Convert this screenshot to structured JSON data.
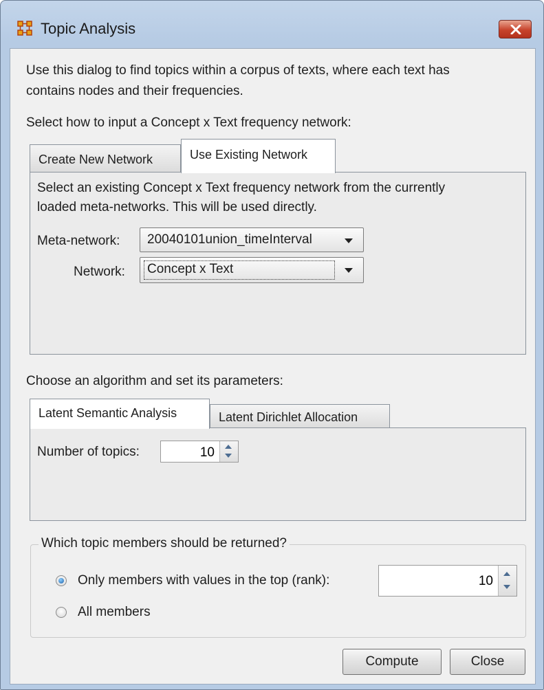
{
  "window": {
    "title": "Topic Analysis",
    "app_icon": "network-grid-icon",
    "close_icon": "close-icon"
  },
  "intro": "Use this dialog to find topics within a corpus of texts, where each text has contains nodes and their frequencies.",
  "intro_line1": "Use this dialog to find topics within a corpus of texts, where each text has",
  "intro_line2": "contains nodes and their frequencies.",
  "input_section": {
    "label": "Select how to input a Concept x Text frequency network:",
    "tabs": [
      {
        "label": "Create New Network",
        "selected": false
      },
      {
        "label": "Use Existing Network",
        "selected": true
      }
    ],
    "description_line1": "Select an existing Concept x Text frequency network from the currently",
    "description_line2": "loaded meta-networks. This will be used directly.",
    "meta_network_label": "Meta-network:",
    "meta_network_value": "20040101union_timeInterval",
    "network_label": "Network:",
    "network_value": "Concept x Text"
  },
  "algorithm_section": {
    "label": "Choose an algorithm and set its parameters:",
    "tabs": [
      {
        "label": "Latent Semantic Analysis",
        "selected": true
      },
      {
        "label": "Latent Dirichlet Allocation",
        "selected": false
      }
    ],
    "num_topics_label": "Number of topics:",
    "num_topics_value": "10"
  },
  "members_section": {
    "title": "Which topic members should be returned?",
    "options": [
      {
        "label": "Only members with values in the top (rank):",
        "selected": true
      },
      {
        "label": "All members",
        "selected": false
      }
    ],
    "rank_value": "10"
  },
  "buttons": {
    "compute": "Compute",
    "close": "Close"
  },
  "colors": {
    "title_bar": "#b6cbe4",
    "close_button": "#c7432c",
    "dialog_bg": "#f0f0f0"
  }
}
